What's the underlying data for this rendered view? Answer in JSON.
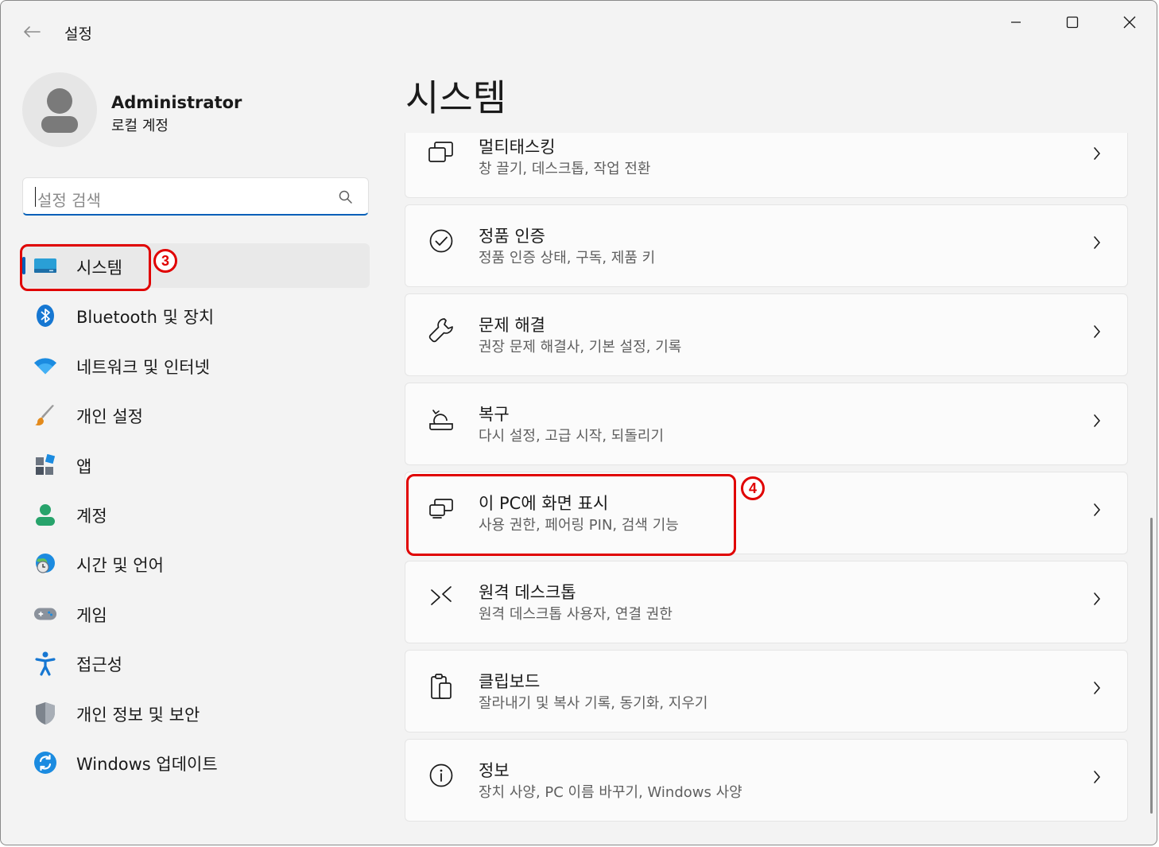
{
  "window": {
    "title": "설정"
  },
  "profile": {
    "name": "Administrator",
    "account_type": "로컬 계정"
  },
  "search": {
    "placeholder": "설정 검색"
  },
  "sidebar": {
    "items": [
      {
        "label": "시스템",
        "icon": "monitor-icon",
        "selected": true
      },
      {
        "label": "Bluetooth 및 장치",
        "icon": "bluetooth-icon"
      },
      {
        "label": "네트워크 및 인터넷",
        "icon": "wifi-icon"
      },
      {
        "label": "개인 설정",
        "icon": "paintbrush-icon"
      },
      {
        "label": "앱",
        "icon": "apps-icon"
      },
      {
        "label": "계정",
        "icon": "account-icon"
      },
      {
        "label": "시간 및 언어",
        "icon": "globe-clock-icon"
      },
      {
        "label": "게임",
        "icon": "gamepad-icon"
      },
      {
        "label": "접근성",
        "icon": "accessibility-icon"
      },
      {
        "label": "개인 정보 및 보안",
        "icon": "shield-icon"
      },
      {
        "label": "Windows 업데이트",
        "icon": "windows-update-icon"
      }
    ]
  },
  "main": {
    "title": "시스템",
    "items": [
      {
        "title": "멀티태스킹",
        "subtitle": "창 끌기, 데스크톱, 작업 전환",
        "icon": "multitasking-icon"
      },
      {
        "title": "정품 인증",
        "subtitle": "정품 인증 상태, 구독, 제품 키",
        "icon": "activation-check-icon"
      },
      {
        "title": "문제 해결",
        "subtitle": "권장 문제 해결사, 기본 설정, 기록",
        "icon": "wrench-icon"
      },
      {
        "title": "복구",
        "subtitle": "다시 설정, 고급 시작, 되돌리기",
        "icon": "recovery-icon"
      },
      {
        "title": "이 PC에 화면 표시",
        "subtitle": "사용 권한, 페어링 PIN, 검색 기능",
        "icon": "project-to-pc-icon"
      },
      {
        "title": "원격 데스크톱",
        "subtitle": "원격 데스크톱 사용자, 연결 권한",
        "icon": "remote-desktop-icon"
      },
      {
        "title": "클립보드",
        "subtitle": "잘라내기 및 복사 기록, 동기화, 지우기",
        "icon": "clipboard-icon"
      },
      {
        "title": "정보",
        "subtitle": "장치 사양, PC 이름 바꾸기, Windows 사양",
        "icon": "info-icon"
      }
    ]
  },
  "annotations": {
    "step_sidebar": "3",
    "step_item": "4"
  },
  "colors": {
    "accent": "#005fb8",
    "annotation": "#e00000",
    "background": "#f3f3f3",
    "card": "#fbfbfb"
  }
}
